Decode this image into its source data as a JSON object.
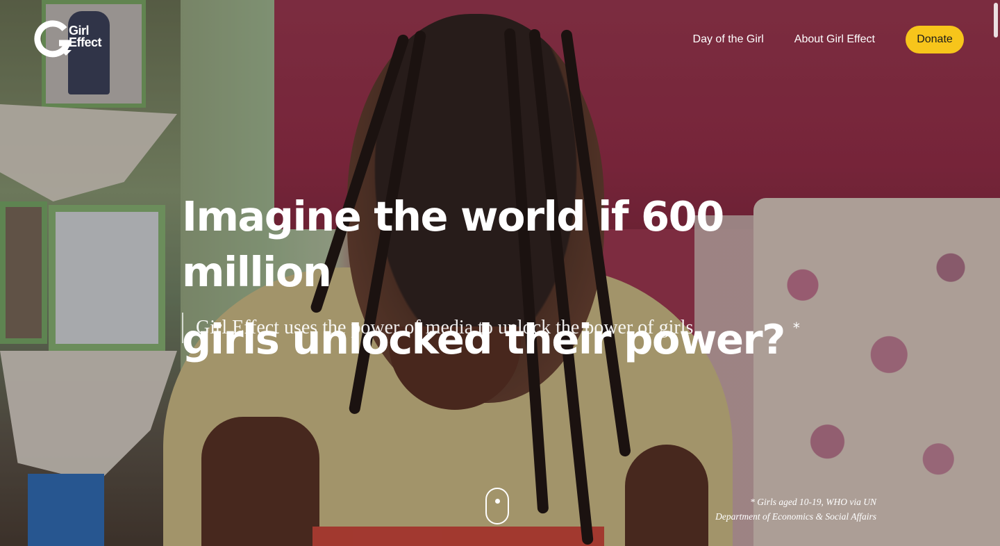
{
  "brand": {
    "logo_line1": "Girl",
    "logo_line2": "Effect",
    "logo_icon": "girl-effect-logo-icon"
  },
  "nav": {
    "items": [
      {
        "label": "Day of the Girl"
      },
      {
        "label": "About Girl Effect"
      }
    ],
    "donate_label": "Donate"
  },
  "hero": {
    "headline_line1": "Imagine the world if 600 million",
    "headline_line2": "girls unlocked their power?",
    "asterisk": "*",
    "subheadline": "Girl Effect uses the power of media to unlock the power of girls"
  },
  "footnote": {
    "line1": "* Girls aged 10-19, WHO via UN",
    "line2": "Department of Economics & Social Affairs"
  },
  "colors": {
    "accent": "#f7c51b",
    "text": "#ffffff"
  },
  "icons": {
    "scroll": "mouse-scroll-icon"
  }
}
